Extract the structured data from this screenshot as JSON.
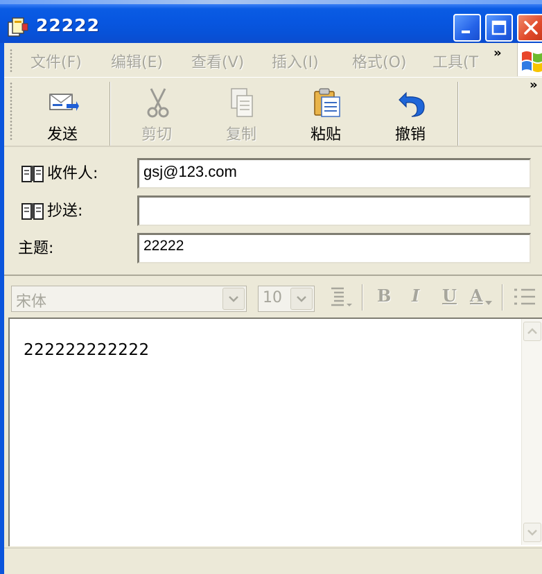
{
  "window": {
    "title": "22222"
  },
  "menu": {
    "items": [
      "文件(F)",
      "编辑(E)",
      "查看(V)",
      "插入(I)",
      "格式(O)",
      "工具(T"
    ],
    "overflow": "»"
  },
  "toolbar": {
    "buttons": [
      {
        "label": "发送",
        "icon": "send-icon",
        "enabled": true
      },
      {
        "label": "剪切",
        "icon": "scissors-icon",
        "enabled": false
      },
      {
        "label": "复制",
        "icon": "copy-icon",
        "enabled": false
      },
      {
        "label": "粘贴",
        "icon": "paste-icon",
        "enabled": true
      },
      {
        "label": "撤销",
        "icon": "undo-icon",
        "enabled": true
      }
    ],
    "overflow": "»"
  },
  "fields": {
    "to_label": "收件人:",
    "to_value": "gsj@123.com",
    "cc_label": "抄送:",
    "cc_value": "",
    "subject_label": "主题:",
    "subject_value": "22222"
  },
  "format": {
    "font": "宋体",
    "size": "10",
    "bold": "B",
    "italic": "I",
    "underline": "U",
    "font_color": "A"
  },
  "body": {
    "text": "222222222222"
  },
  "colors": {
    "titlebar": "#0856e0",
    "chrome": "#ece9d8",
    "disabled_text": "#a7a69c",
    "close_button": "#e0492a"
  }
}
